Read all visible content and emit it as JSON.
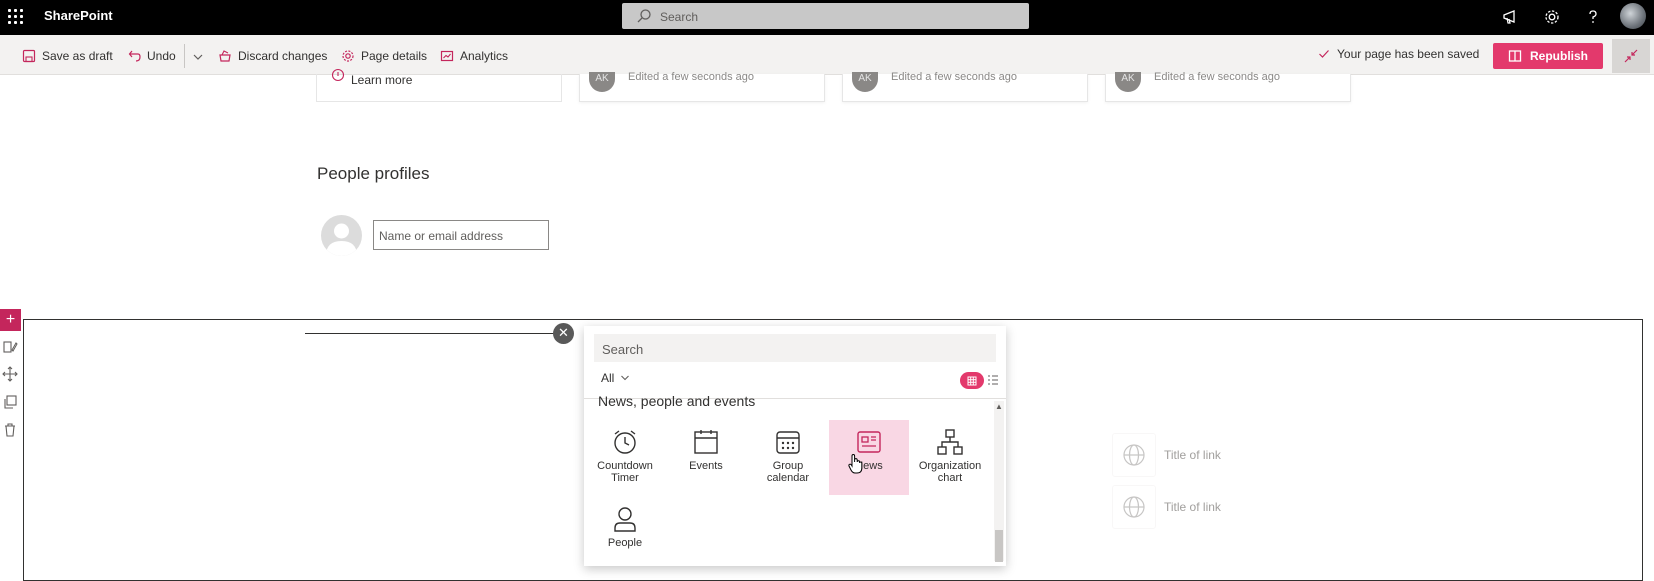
{
  "suite": {
    "brand": "SharePoint",
    "search_placeholder": "Search"
  },
  "command_bar": {
    "save_draft": "Save as draft",
    "undo": "Undo",
    "discard": "Discard changes",
    "page_details": "Page details",
    "analytics": "Analytics",
    "saved_status": "Your page has been saved",
    "republish": "Republish"
  },
  "cards": {
    "learn_more": "Learn more",
    "edited": [
      "Edited a few seconds ago",
      "Edited a few seconds ago",
      "Edited a few seconds ago"
    ],
    "initials": [
      "AK",
      "AK",
      "AK"
    ]
  },
  "people": {
    "title": "People profiles",
    "input_placeholder": "Name or email address"
  },
  "toolbox": {
    "search_placeholder": "Search",
    "filter": "All",
    "category": "News, people and events",
    "items": [
      {
        "label": "Countdown\nTimer",
        "icon": "clock-icon"
      },
      {
        "label": "Events",
        "icon": "calendar-icon"
      },
      {
        "label": "Group\ncalendar",
        "icon": "group-calendar-icon"
      },
      {
        "label": "News",
        "icon": "news-icon"
      },
      {
        "label": "Organization\nchart",
        "icon": "org-chart-icon"
      },
      {
        "label": "People",
        "icon": "person-icon"
      }
    ]
  },
  "quick_links": [
    "Title of link",
    "Title of link"
  ],
  "colors": {
    "accent": "#e3396c",
    "suite_bar": "#000000",
    "news_highlight": "#f9d7e4"
  }
}
